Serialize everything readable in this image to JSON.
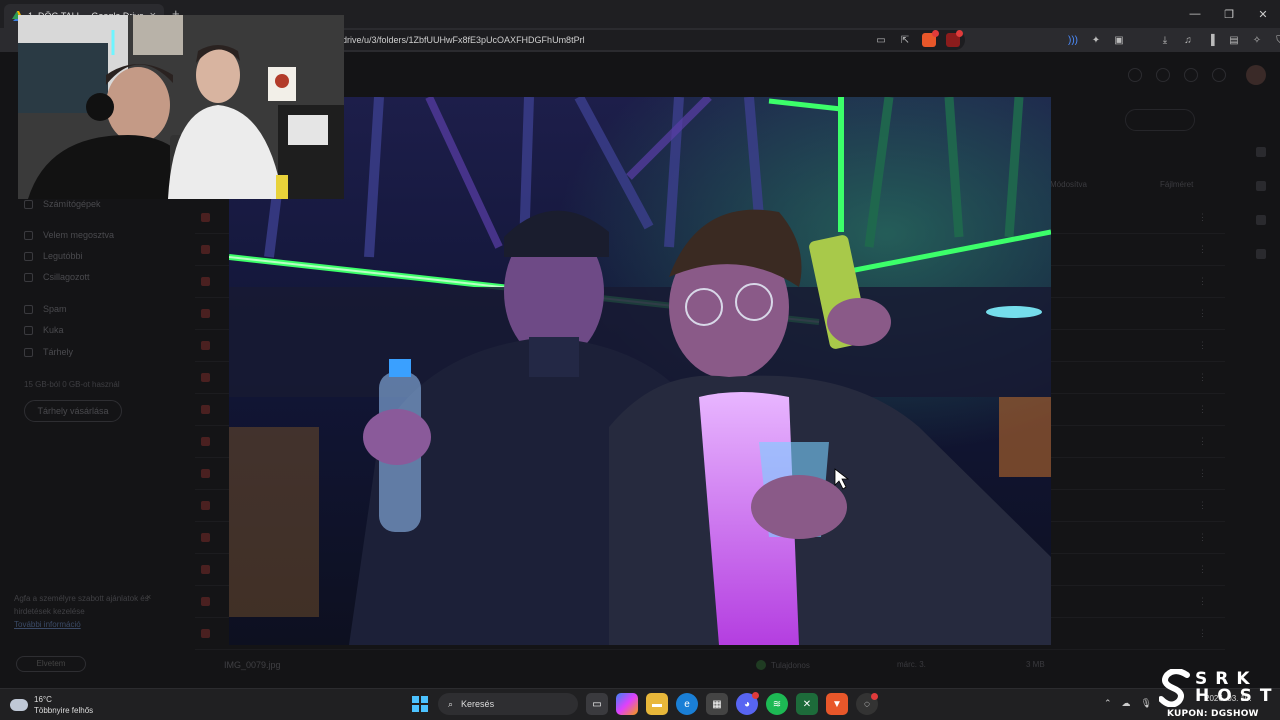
{
  "browser": {
    "tab_title": "1. DÖG TALL – Google Drive",
    "new_tab": "+",
    "url": "drive/u/3/folders/1ZbfUUHwFx8fE3pUcOAXFHDGFhUm8tPrl"
  },
  "drive": {
    "sidebar": [
      {
        "label": "Számítógépek"
      },
      {
        "label": "Velem megosztva"
      },
      {
        "label": "Legutóbbi"
      },
      {
        "label": "Csillagozott"
      },
      {
        "label": "Spam"
      },
      {
        "label": "Kuka"
      },
      {
        "label": "Tárhely"
      }
    ],
    "storage_text": "15 GB-ból 0 GB-ot használ",
    "storage_button": "Tárhely vásárlása",
    "notice_text": "Agfa a személyre szabott ajánlatok és hirdetések kezelése",
    "notice_link": "További információ",
    "notice_button": "Elvetem",
    "header_modified": "Módosítva",
    "header_size": "Fájlméret",
    "last_file_name": "IMG_0079.jpg",
    "last_file_owner": "Tulajdonos",
    "last_file_date": "márc. 3.",
    "last_file_size": "3 MB"
  },
  "taskbar": {
    "weather_temp": "16°C",
    "weather_desc": "Többnyire felhős",
    "search_label": "Keresés",
    "clock_date": "2026. 03. 10."
  },
  "watermark": {
    "brand": "SRK HOST",
    "coupon": "KUPON: DGSHOW"
  }
}
